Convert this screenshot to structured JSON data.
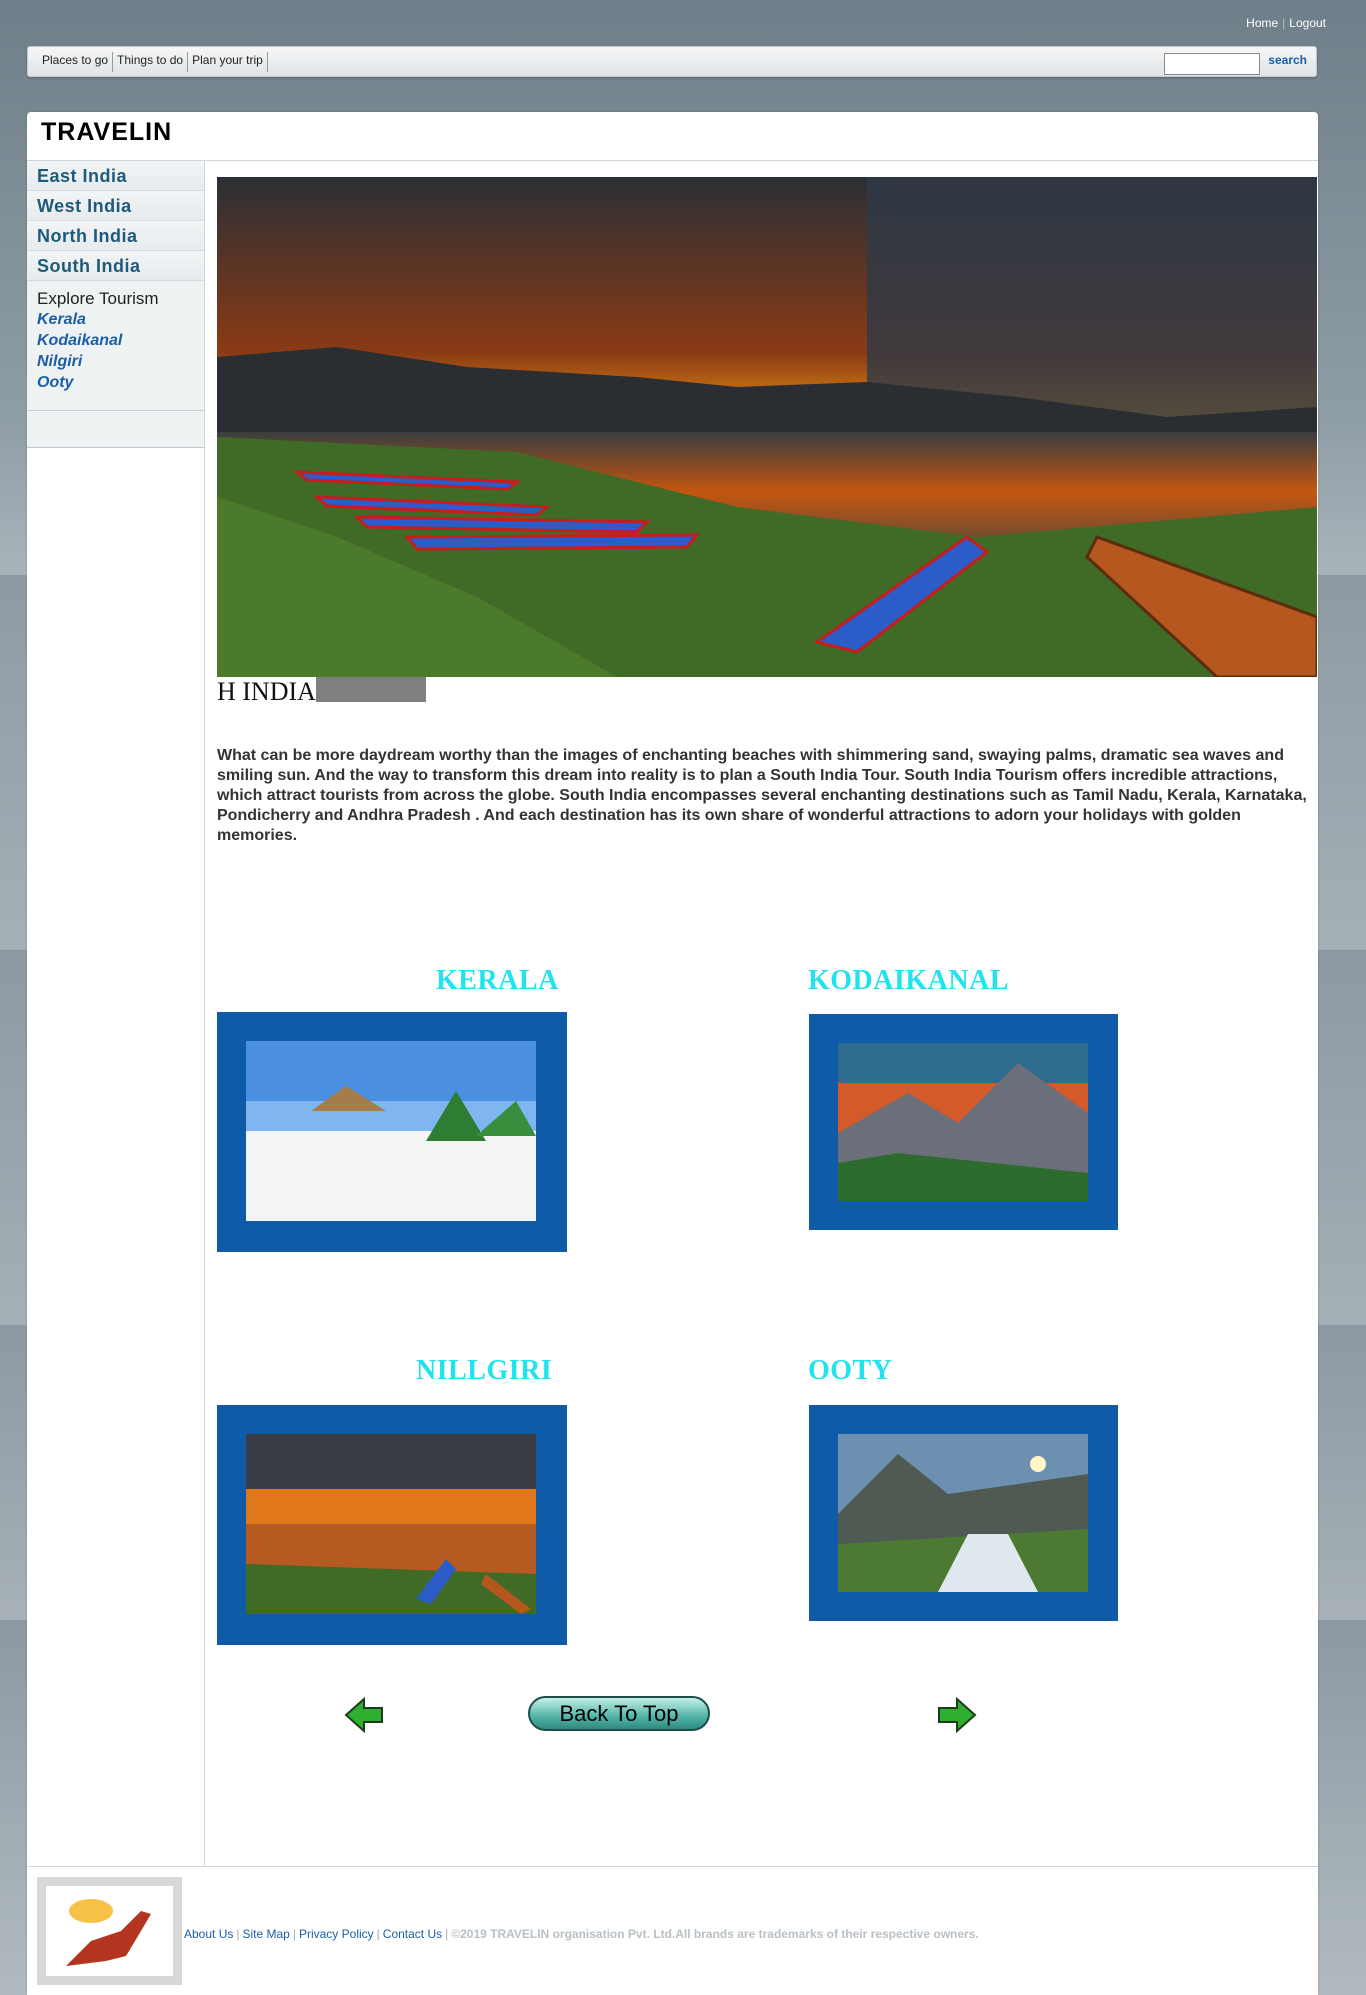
{
  "top_links": {
    "home": "Home",
    "logout": "Logout"
  },
  "navbar": {
    "menu": [
      "Places to go",
      "Things to do",
      "Plan your trip"
    ],
    "search_value": "",
    "search_label": "search"
  },
  "site": {
    "logo": "TRAVELIN"
  },
  "sidebar": {
    "regions": [
      "East India",
      "West India",
      "North India",
      "South India"
    ],
    "explore_title": "Explore Tourism",
    "explore_links": [
      "Kerala",
      "Kodaikanal",
      "Nilgiri",
      "Ooty"
    ]
  },
  "main": {
    "section_title": "H INDIA",
    "intro": "What can be more daydream worthy than the images of enchanting beaches with shimmering sand, swaying palms, dramatic sea waves and smiling sun. And the way to transform this dream into reality is to plan a South India Tour. South India Tourism offers incredible attractions, which attract tourists from across the globe. South India encompasses several enchanting destinations such as Tamil Nadu, Kerala, Karnataka, Pondicherry and Andhra Pradesh . And each destination has its own share of wonderful attractions to adorn your holidays with golden memories.",
    "places": [
      {
        "name": "KERALA"
      },
      {
        "name": "KODAIKANAL"
      },
      {
        "name": "NILLGIRI"
      },
      {
        "name": "OOTY"
      }
    ],
    "back_to_top": "Back To Top"
  },
  "footer": {
    "links": [
      "About Us",
      "Site Map",
      "Privacy Policy",
      "Contact Us"
    ],
    "copyright": "©2019 TRAVELIN organisation Pvt. Ltd.All brands are trademarks of their respective owners."
  },
  "colors": {
    "place_title": "#21e3f0",
    "frame": "#0f5ba7",
    "link": "#1a5ea7"
  }
}
